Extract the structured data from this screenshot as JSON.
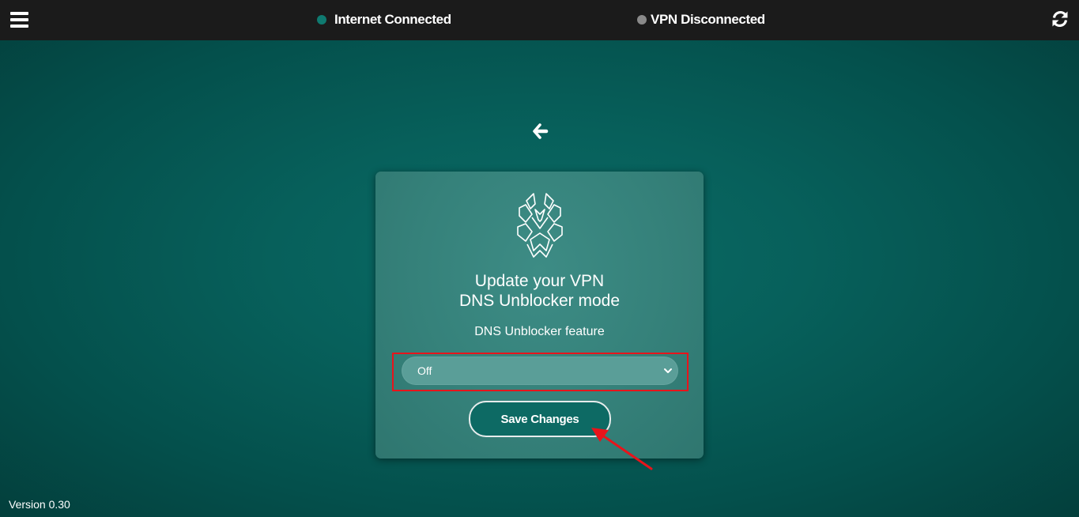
{
  "topbar": {
    "menu_icon": "hamburger-icon",
    "internet_status": {
      "label": "Internet Connected",
      "dot_color": "#0f7a70"
    },
    "vpn_status": {
      "label": "VPN Disconnected",
      "dot_color": "#8a8a8a"
    },
    "refresh_icon": "refresh-icon"
  },
  "back_icon": "arrow-left-icon",
  "card": {
    "logo_icon": "spider-logo-icon",
    "title_line1": "Update your VPN",
    "title_line2": "DNS Unblocker mode",
    "feature_label": "DNS Unblocker feature",
    "select": {
      "value": "Off"
    },
    "save_label": "Save Changes"
  },
  "annotation": {
    "highlight_color": "#e8141b"
  },
  "version": "Version 0.30"
}
